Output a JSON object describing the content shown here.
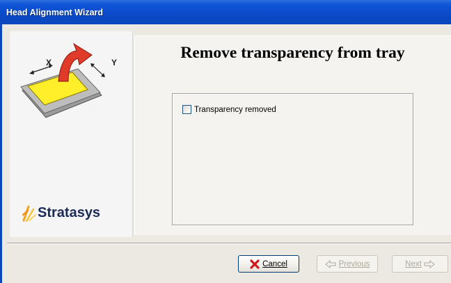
{
  "window": {
    "title": "Head Alignment Wizard"
  },
  "step": {
    "heading": "Remove transparency from tray",
    "illustration": {
      "x_label": "X",
      "y_label": "Y"
    },
    "checkbox": {
      "label": "Transparency removed",
      "checked": false
    }
  },
  "branding": {
    "logo_text": "Stratasys"
  },
  "buttons": {
    "cancel": "Cancel",
    "previous": "Previous",
    "next": "Next"
  },
  "colors": {
    "titlebar": "#0b47bd",
    "tray_highlight": "#ffee2a",
    "arrow": "#e03a2a",
    "logo_accent": "#f6a31a"
  }
}
